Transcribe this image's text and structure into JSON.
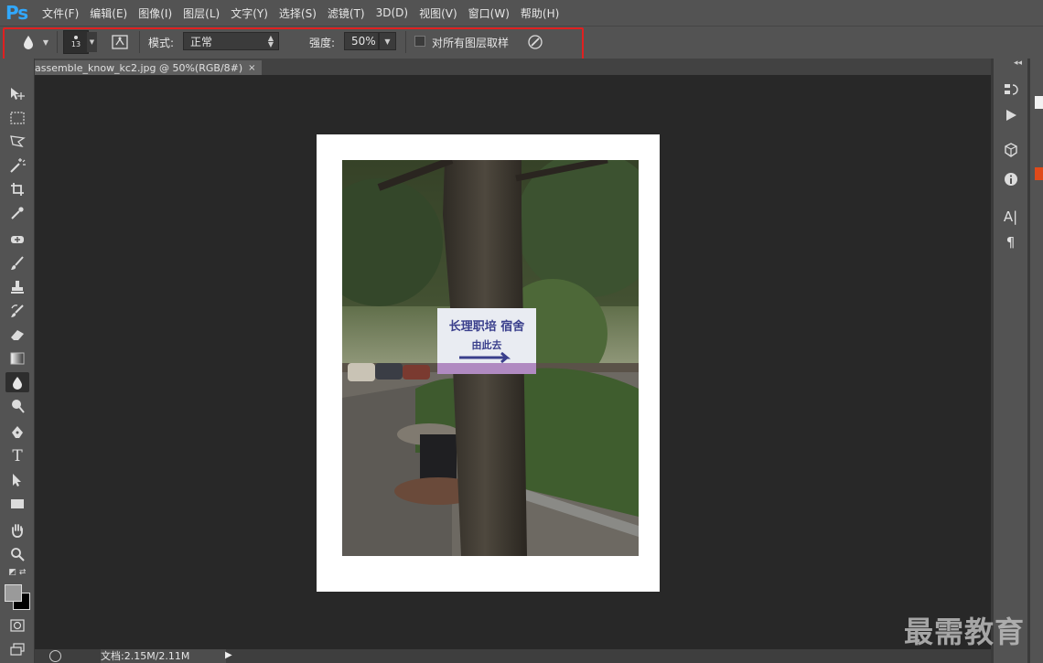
{
  "app": {
    "logo": "Ps"
  },
  "menu": {
    "items": [
      "文件(F)",
      "编辑(E)",
      "图像(I)",
      "图层(L)",
      "文字(Y)",
      "选择(S)",
      "滤镜(T)",
      "3D(D)",
      "视图(V)",
      "窗口(W)",
      "帮助(H)"
    ]
  },
  "options": {
    "brush_size": "13",
    "mode_label": "模式:",
    "mode_value": "正常",
    "strength_label": "强度:",
    "strength_value": "50%",
    "sample_all_layers_label": "对所有图层取样",
    "sample_all_layers_checked": false
  },
  "document": {
    "tab_title": "assemble_know_kc2.jpg @ 50%(RGB/8#)",
    "close_glyph": "×"
  },
  "sign": {
    "line1": "长理职培  宿舍",
    "line2": "由此去"
  },
  "status": {
    "doc_info": "文档:2.15M/2.11M"
  },
  "watermark": {
    "text": "最需教育"
  },
  "colors": {
    "highlight_box": "#e02020",
    "ps_logo": "#31a8ff",
    "foreground": "#9a9a9a",
    "background": "#000000"
  }
}
